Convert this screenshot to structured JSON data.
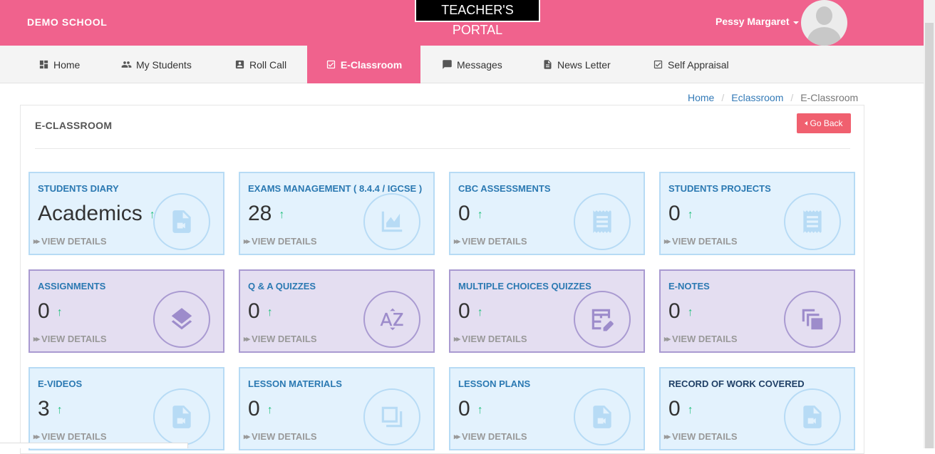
{
  "header": {
    "school_name": "DEMO SCHOOL",
    "portal_title": "TEACHER'S PORTAL",
    "user_name": "Pessy Margaret"
  },
  "nav": {
    "items": [
      {
        "label": "Home",
        "icon": "dashboard-icon"
      },
      {
        "label": "My Students",
        "icon": "people-icon"
      },
      {
        "label": "Roll Call",
        "icon": "contact-card-icon"
      },
      {
        "label": "E-Classroom",
        "icon": "checkbox-icon",
        "active": true
      },
      {
        "label": "Messages",
        "icon": "message-icon"
      },
      {
        "label": "News Letter",
        "icon": "document-icon"
      },
      {
        "label": "Self Appraisal",
        "icon": "checkbox-icon"
      }
    ]
  },
  "breadcrumb": {
    "home": "Home",
    "section": "Eclassroom",
    "current": "E-Classroom",
    "separator": "/"
  },
  "panel": {
    "title": "E-CLASSROOM",
    "go_back": "Go Back"
  },
  "cards": [
    {
      "title": "STUDENTS DIARY",
      "value": "Academics",
      "details": "VIEW DETAILS",
      "icon": "video-file-icon",
      "color": "blue"
    },
    {
      "title": "EXAMS MANAGEMENT ( 8.4.4 / IGCSE )",
      "value": "28",
      "details": "VIEW DETAILS",
      "icon": "line-chart-icon",
      "color": "blue"
    },
    {
      "title": "CBC ASSESSMENTS",
      "value": "0",
      "details": "VIEW DETAILS",
      "icon": "receipt-icon",
      "color": "blue"
    },
    {
      "title": "STUDENTS PROJECTS",
      "value": "0",
      "details": "VIEW DETAILS",
      "icon": "receipt-icon",
      "color": "blue"
    },
    {
      "title": "ASSIGNMENTS",
      "value": "0",
      "details": "VIEW DETAILS",
      "icon": "layers-icon",
      "color": "purple"
    },
    {
      "title": "Q & A QUIZZES",
      "value": "0",
      "details": "VIEW DETAILS",
      "icon": "sort-az-icon",
      "color": "purple"
    },
    {
      "title": "MULTIPLE CHOICES QUIZZES",
      "value": "0",
      "details": "VIEW DETAILS",
      "icon": "edit-table-icon",
      "color": "purple"
    },
    {
      "title": "E-NOTES",
      "value": "0",
      "details": "VIEW DETAILS",
      "icon": "copy-icon",
      "color": "purple"
    },
    {
      "title": "E-VIDEOS",
      "value": "3",
      "details": "VIEW DETAILS",
      "icon": "video-file-icon",
      "color": "blue"
    },
    {
      "title": "LESSON MATERIALS",
      "value": "0",
      "details": "VIEW DETAILS",
      "icon": "flip-to-back-icon",
      "color": "blue"
    },
    {
      "title": "LESSON PLANS",
      "value": "0",
      "details": "VIEW DETAILS",
      "icon": "video-file-icon",
      "color": "blue"
    },
    {
      "title": "RECORD OF WORK COVERED",
      "value": "0",
      "details": "VIEW DETAILS",
      "icon": "video-file-icon",
      "color": "blue"
    }
  ],
  "colors": {
    "brand_pink": "#f0628d",
    "go_back_red": "#f0606f",
    "card_blue_bg": "#e3f2fd",
    "card_purple_bg": "#e4def1",
    "title_blue": "#2b79b2",
    "up_green": "#27c280"
  }
}
